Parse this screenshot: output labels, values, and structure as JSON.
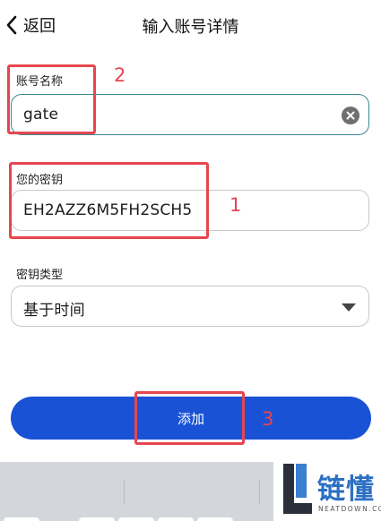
{
  "header": {
    "back_label": "返回",
    "title": "输入账号详情"
  },
  "form": {
    "account_name": {
      "label": "账号名称",
      "value": "gate"
    },
    "secret_key": {
      "label": "您的密钥",
      "value": "EH2AZZ6M5FH2SCH5"
    },
    "key_type": {
      "label": "密钥类型",
      "selected": "基于时间"
    },
    "add_label": "添加"
  },
  "annotations": {
    "n1": "1",
    "n2": "2",
    "n3": "3",
    "color": "#e6464f"
  },
  "watermark": {
    "text": "链懂",
    "sub": "NEATDOWN.COM"
  },
  "colors": {
    "accent": "#1a52d6",
    "active_border": "#3a8a93"
  }
}
